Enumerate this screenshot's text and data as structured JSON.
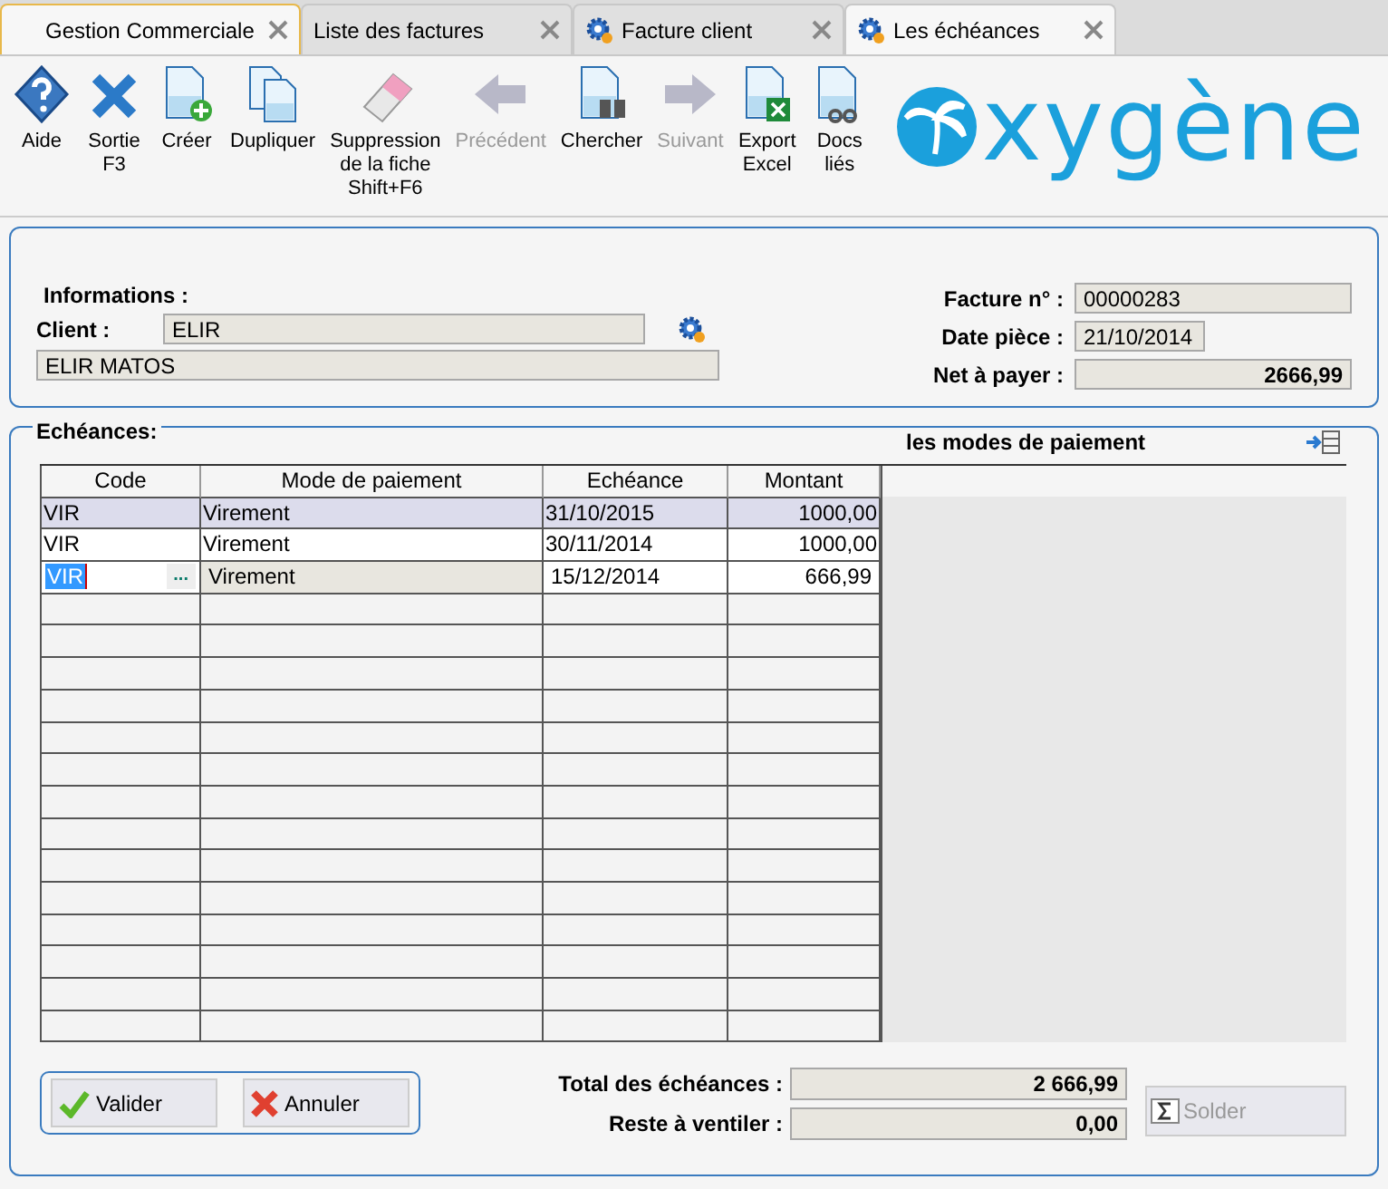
{
  "tabs": [
    {
      "label": "Gestion Commerciale",
      "selected": true,
      "kind": "app"
    },
    {
      "label": "Liste des factures",
      "selected": false,
      "kind": "plain"
    },
    {
      "label": "Facture client",
      "selected": false,
      "kind": "gear"
    },
    {
      "label": "Les échéances",
      "selected": true,
      "kind": "gear"
    }
  ],
  "toolbar": [
    {
      "label": "Aide",
      "kind": "help",
      "disabled": false
    },
    {
      "label": "Sortie\nF3",
      "kind": "exit",
      "disabled": false
    },
    {
      "label": "Créer",
      "kind": "create",
      "disabled": false
    },
    {
      "label": "Dupliquer",
      "kind": "duplicate",
      "disabled": false
    },
    {
      "label": "Suppression\nde la fiche\nShift+F6",
      "kind": "erase",
      "disabled": false
    },
    {
      "label": "Précédent",
      "kind": "prev",
      "disabled": true
    },
    {
      "label": "Chercher",
      "kind": "search",
      "disabled": false
    },
    {
      "label": "Suivant",
      "kind": "next",
      "disabled": true
    },
    {
      "label": "Export\nExcel",
      "kind": "excel",
      "disabled": false
    },
    {
      "label": "Docs\nliés",
      "kind": "docs",
      "disabled": false
    }
  ],
  "logo": "xygène",
  "info": {
    "title": "Informations :",
    "client_label": "Client :",
    "client_code": "ELIR",
    "client_name": "ELIR MATOS",
    "fields": [
      {
        "label": "Facture n° :",
        "value": "00000283",
        "kind": "text"
      },
      {
        "label": "Date pièce :",
        "value": "21/10/2014",
        "kind": "short"
      },
      {
        "label": "Net à payer :",
        "value": "2666,99",
        "kind": "amount"
      }
    ]
  },
  "echeances": {
    "title": "Echéances:",
    "side_title": "les modes de paiement",
    "columns": [
      "Code",
      "Mode de paiement",
      "Echéance",
      "Montant"
    ],
    "rows": [
      {
        "code": "VIR",
        "mode": "Virement",
        "date": "31/10/2015",
        "amount": "1000,00",
        "selected": true,
        "editing": false
      },
      {
        "code": "VIR",
        "mode": "Virement",
        "date": "30/11/2014",
        "amount": "1000,00",
        "selected": false,
        "editing": false
      },
      {
        "code": "VIR",
        "mode": "Virement",
        "date": "15/12/2014",
        "amount": "666,99",
        "selected": false,
        "editing": true
      }
    ],
    "edit_button": "...",
    "buttons": [
      {
        "label": "Valider",
        "kind": "ok"
      },
      {
        "label": "Annuler",
        "kind": "cancel"
      }
    ],
    "totals": [
      {
        "label": "Total des échéances :",
        "value": "2 666,99"
      },
      {
        "label": "Reste à ventiler :",
        "value": "0,00"
      }
    ],
    "solder": {
      "label": "Solder",
      "disabled": true
    }
  }
}
